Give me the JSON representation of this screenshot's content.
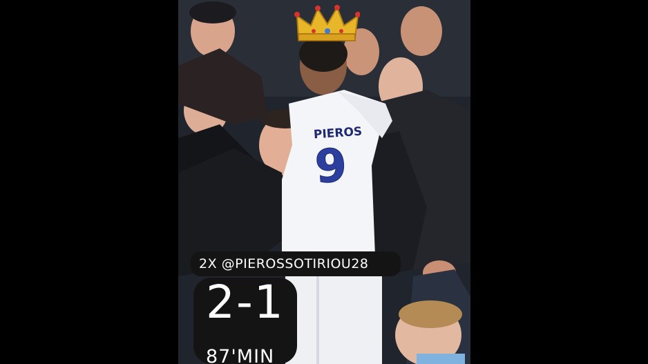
{
  "story": {
    "caption_line": "2X @PIEROSSOTIRIOU28",
    "score": "2-1",
    "minute": "87'MIN",
    "shirt_name": "PIEROS",
    "shirt_number": "9"
  },
  "colors": {
    "page_background": "#000000",
    "caption_background": "#141414",
    "text": "#ffffff",
    "kit_white": "#f4f5f8",
    "kit_blue": "#2c3f9e",
    "crown_gold": "#e8b629"
  },
  "icons": [
    "crown-sticker"
  ]
}
